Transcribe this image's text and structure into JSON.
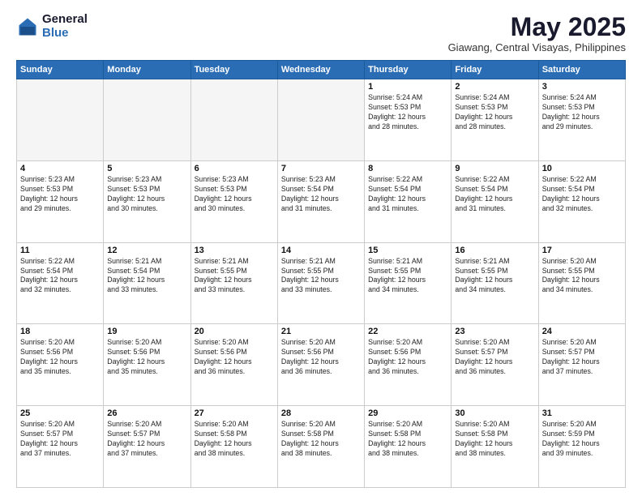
{
  "header": {
    "logo_general": "General",
    "logo_blue": "Blue",
    "month_title": "May 2025",
    "location": "Giawang, Central Visayas, Philippines"
  },
  "weekdays": [
    "Sunday",
    "Monday",
    "Tuesday",
    "Wednesday",
    "Thursday",
    "Friday",
    "Saturday"
  ],
  "weeks": [
    [
      {
        "day": "",
        "info": "",
        "empty": true
      },
      {
        "day": "",
        "info": "",
        "empty": true
      },
      {
        "day": "",
        "info": "",
        "empty": true
      },
      {
        "day": "",
        "info": "",
        "empty": true
      },
      {
        "day": "1",
        "info": "Sunrise: 5:24 AM\nSunset: 5:53 PM\nDaylight: 12 hours\nand 28 minutes.",
        "empty": false
      },
      {
        "day": "2",
        "info": "Sunrise: 5:24 AM\nSunset: 5:53 PM\nDaylight: 12 hours\nand 28 minutes.",
        "empty": false
      },
      {
        "day": "3",
        "info": "Sunrise: 5:24 AM\nSunset: 5:53 PM\nDaylight: 12 hours\nand 29 minutes.",
        "empty": false
      }
    ],
    [
      {
        "day": "4",
        "info": "Sunrise: 5:23 AM\nSunset: 5:53 PM\nDaylight: 12 hours\nand 29 minutes.",
        "empty": false
      },
      {
        "day": "5",
        "info": "Sunrise: 5:23 AM\nSunset: 5:53 PM\nDaylight: 12 hours\nand 30 minutes.",
        "empty": false
      },
      {
        "day": "6",
        "info": "Sunrise: 5:23 AM\nSunset: 5:53 PM\nDaylight: 12 hours\nand 30 minutes.",
        "empty": false
      },
      {
        "day": "7",
        "info": "Sunrise: 5:23 AM\nSunset: 5:54 PM\nDaylight: 12 hours\nand 31 minutes.",
        "empty": false
      },
      {
        "day": "8",
        "info": "Sunrise: 5:22 AM\nSunset: 5:54 PM\nDaylight: 12 hours\nand 31 minutes.",
        "empty": false
      },
      {
        "day": "9",
        "info": "Sunrise: 5:22 AM\nSunset: 5:54 PM\nDaylight: 12 hours\nand 31 minutes.",
        "empty": false
      },
      {
        "day": "10",
        "info": "Sunrise: 5:22 AM\nSunset: 5:54 PM\nDaylight: 12 hours\nand 32 minutes.",
        "empty": false
      }
    ],
    [
      {
        "day": "11",
        "info": "Sunrise: 5:22 AM\nSunset: 5:54 PM\nDaylight: 12 hours\nand 32 minutes.",
        "empty": false
      },
      {
        "day": "12",
        "info": "Sunrise: 5:21 AM\nSunset: 5:54 PM\nDaylight: 12 hours\nand 33 minutes.",
        "empty": false
      },
      {
        "day": "13",
        "info": "Sunrise: 5:21 AM\nSunset: 5:55 PM\nDaylight: 12 hours\nand 33 minutes.",
        "empty": false
      },
      {
        "day": "14",
        "info": "Sunrise: 5:21 AM\nSunset: 5:55 PM\nDaylight: 12 hours\nand 33 minutes.",
        "empty": false
      },
      {
        "day": "15",
        "info": "Sunrise: 5:21 AM\nSunset: 5:55 PM\nDaylight: 12 hours\nand 34 minutes.",
        "empty": false
      },
      {
        "day": "16",
        "info": "Sunrise: 5:21 AM\nSunset: 5:55 PM\nDaylight: 12 hours\nand 34 minutes.",
        "empty": false
      },
      {
        "day": "17",
        "info": "Sunrise: 5:20 AM\nSunset: 5:55 PM\nDaylight: 12 hours\nand 34 minutes.",
        "empty": false
      }
    ],
    [
      {
        "day": "18",
        "info": "Sunrise: 5:20 AM\nSunset: 5:56 PM\nDaylight: 12 hours\nand 35 minutes.",
        "empty": false
      },
      {
        "day": "19",
        "info": "Sunrise: 5:20 AM\nSunset: 5:56 PM\nDaylight: 12 hours\nand 35 minutes.",
        "empty": false
      },
      {
        "day": "20",
        "info": "Sunrise: 5:20 AM\nSunset: 5:56 PM\nDaylight: 12 hours\nand 36 minutes.",
        "empty": false
      },
      {
        "day": "21",
        "info": "Sunrise: 5:20 AM\nSunset: 5:56 PM\nDaylight: 12 hours\nand 36 minutes.",
        "empty": false
      },
      {
        "day": "22",
        "info": "Sunrise: 5:20 AM\nSunset: 5:56 PM\nDaylight: 12 hours\nand 36 minutes.",
        "empty": false
      },
      {
        "day": "23",
        "info": "Sunrise: 5:20 AM\nSunset: 5:57 PM\nDaylight: 12 hours\nand 36 minutes.",
        "empty": false
      },
      {
        "day": "24",
        "info": "Sunrise: 5:20 AM\nSunset: 5:57 PM\nDaylight: 12 hours\nand 37 minutes.",
        "empty": false
      }
    ],
    [
      {
        "day": "25",
        "info": "Sunrise: 5:20 AM\nSunset: 5:57 PM\nDaylight: 12 hours\nand 37 minutes.",
        "empty": false
      },
      {
        "day": "26",
        "info": "Sunrise: 5:20 AM\nSunset: 5:57 PM\nDaylight: 12 hours\nand 37 minutes.",
        "empty": false
      },
      {
        "day": "27",
        "info": "Sunrise: 5:20 AM\nSunset: 5:58 PM\nDaylight: 12 hours\nand 38 minutes.",
        "empty": false
      },
      {
        "day": "28",
        "info": "Sunrise: 5:20 AM\nSunset: 5:58 PM\nDaylight: 12 hours\nand 38 minutes.",
        "empty": false
      },
      {
        "day": "29",
        "info": "Sunrise: 5:20 AM\nSunset: 5:58 PM\nDaylight: 12 hours\nand 38 minutes.",
        "empty": false
      },
      {
        "day": "30",
        "info": "Sunrise: 5:20 AM\nSunset: 5:58 PM\nDaylight: 12 hours\nand 38 minutes.",
        "empty": false
      },
      {
        "day": "31",
        "info": "Sunrise: 5:20 AM\nSunset: 5:59 PM\nDaylight: 12 hours\nand 39 minutes.",
        "empty": false
      }
    ]
  ]
}
